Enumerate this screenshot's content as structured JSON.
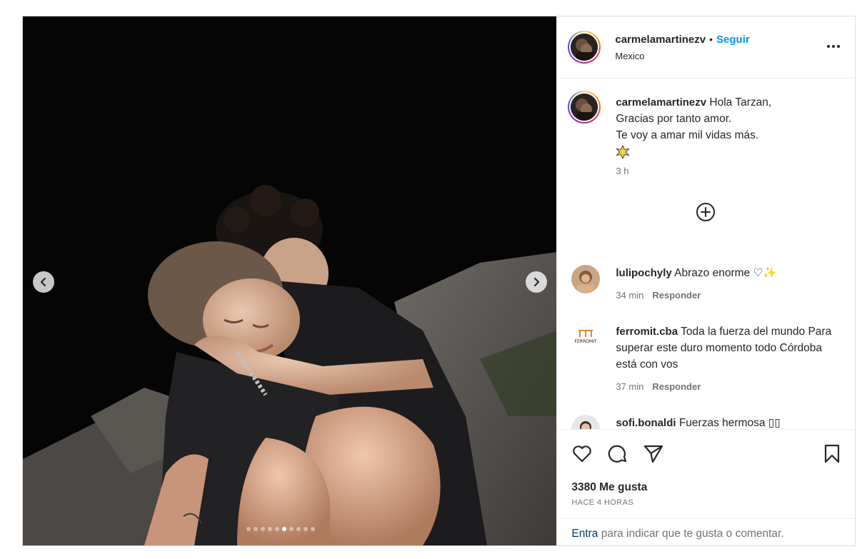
{
  "post": {
    "username": "carmelamartinezv",
    "follow_label": "Seguir",
    "separator": "•",
    "location": "Mexico",
    "caption_lines": [
      "Hola Tarzan,",
      "Gracias por tanto amor.",
      "Te voy a amar mil vidas más."
    ],
    "caption_emoji": "star-icon",
    "caption_time": "3 h",
    "carousel": {
      "total": 10,
      "active_index": 5
    }
  },
  "comments": [
    {
      "username": "lulipochyly",
      "text": "Abrazo enorme ♡✨",
      "time": "34 min",
      "reply_label": "Responder"
    },
    {
      "username": "ferromit.cba",
      "text": "Toda la fuerza del mundo Para superar este duro momento todo Córdoba está con vos",
      "time": "37 min",
      "reply_label": "Responder",
      "avatar_text": "FERROMIT"
    },
    {
      "username": "sofi.bonaldi",
      "text": "Fuerzas hermosa ▯▯"
    }
  ],
  "engagement": {
    "likes": "3380 Me gusta",
    "time_ago": "HACE 4 HORAS"
  },
  "prompt": {
    "link": "Entra",
    "rest": " para indicar que te gusta o comentar."
  },
  "colors": {
    "accent": "#0095f6",
    "text": "#262626",
    "muted": "#737373",
    "link": "#00376b"
  }
}
